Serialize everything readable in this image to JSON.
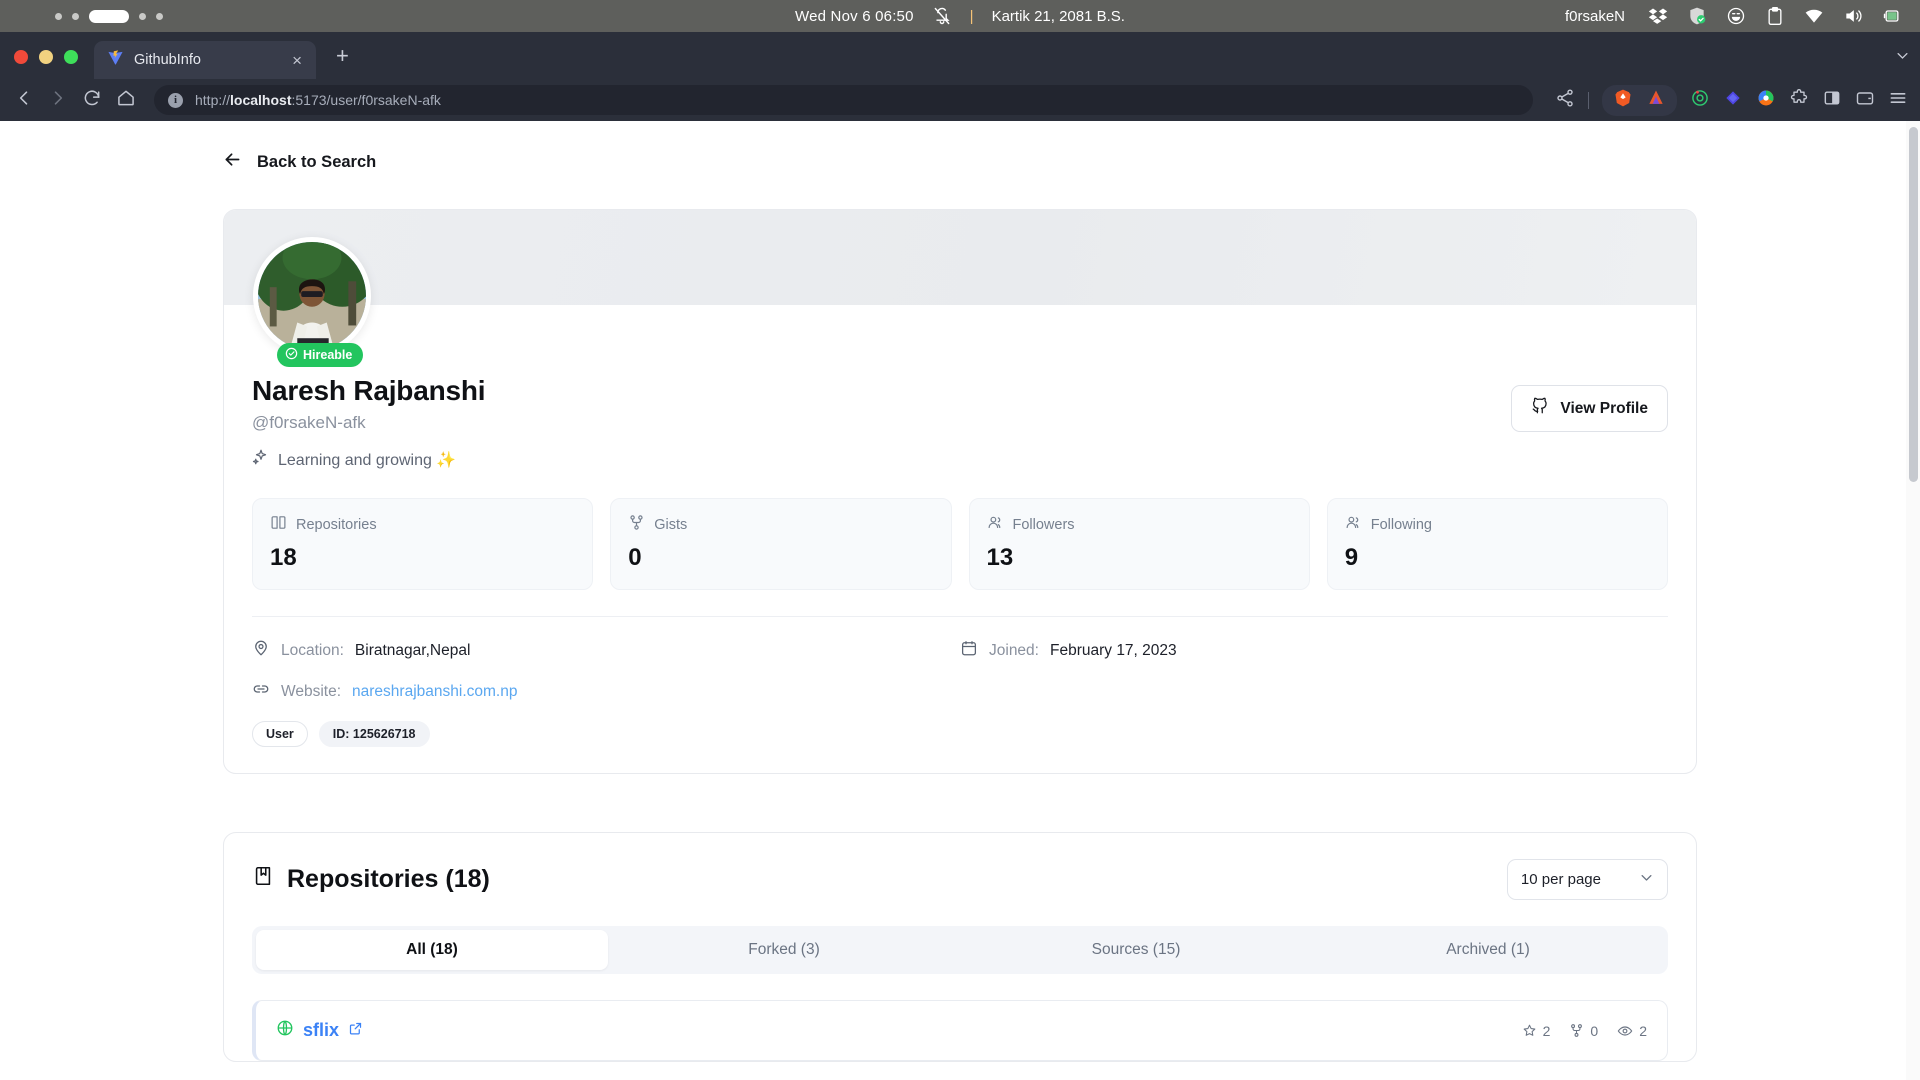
{
  "os_panel": {
    "clock": "Wed Nov 6  06:50",
    "separator": "|",
    "nepali_date": "Kartik 21, 2081 B.S.",
    "user": "f0rsakeN",
    "icons": [
      "notification-bell-muted-icon",
      "dropbox-icon",
      "shield-check-icon",
      "emoji-smile-icon",
      "clipboard-icon",
      "wifi-icon",
      "volume-icon",
      "battery-charging-icon"
    ]
  },
  "browser": {
    "tab": {
      "title": "GithubInfo",
      "favicon": "vite-icon",
      "close_label": "×"
    },
    "new_tab_label": "+",
    "url": {
      "scheme": "http://",
      "host": "localhost",
      "path": ":5173/user/f0rsakeN-afk"
    },
    "nav_icons": [
      "back-icon",
      "forward-icon",
      "reload-icon",
      "home-icon"
    ],
    "right_icons": [
      "share-icon",
      "brave-lion-icon",
      "brave-vpn-icon",
      "orbit-extension-icon",
      "diamond-extension-icon",
      "color-wheel-extension-icon",
      "puzzle-extensions-icon",
      "sidebar-toggle-icon",
      "wallet-icon",
      "menu-icon"
    ]
  },
  "page": {
    "back_link": "Back to Search",
    "profile": {
      "hireable_badge": "Hireable",
      "full_name": "Naresh Rajbanshi",
      "handle": "@f0rsakeN-afk",
      "bio": "Learning and growing ✨",
      "view_profile_button": "View Profile",
      "stats": [
        {
          "label": "Repositories",
          "value": "18",
          "icon": "book-icon"
        },
        {
          "label": "Gists",
          "value": "0",
          "icon": "git-fork-icon"
        },
        {
          "label": "Followers",
          "value": "13",
          "icon": "users-icon"
        },
        {
          "label": "Following",
          "value": "9",
          "icon": "users-icon"
        }
      ],
      "location_label": "Location:",
      "location_value": "Biratnagar,Nepal",
      "website_label": "Website:",
      "website_value": "nareshrajbanshi.com.np",
      "joined_label": "Joined:",
      "joined_value": "February 17, 2023",
      "type_chip": "User",
      "id_chip": "ID: 125626718"
    },
    "repositories": {
      "heading": "Repositories (18)",
      "per_page": "10 per page",
      "tabs": [
        {
          "label": "All (18)",
          "active": true
        },
        {
          "label": "Forked (3)",
          "active": false
        },
        {
          "label": "Sources (15)",
          "active": false
        },
        {
          "label": "Archived (1)",
          "active": false
        }
      ],
      "items": [
        {
          "name": "sflix",
          "stars": "2",
          "forks": "0",
          "watchers": "2"
        }
      ]
    }
  },
  "colors": {
    "accent_blue": "#3b82f6",
    "hireable_green": "#22c55e",
    "link_blue": "#5aa7f0",
    "panel_grey": "#5e5f5c",
    "browser_dark": "#2b2f3a"
  }
}
